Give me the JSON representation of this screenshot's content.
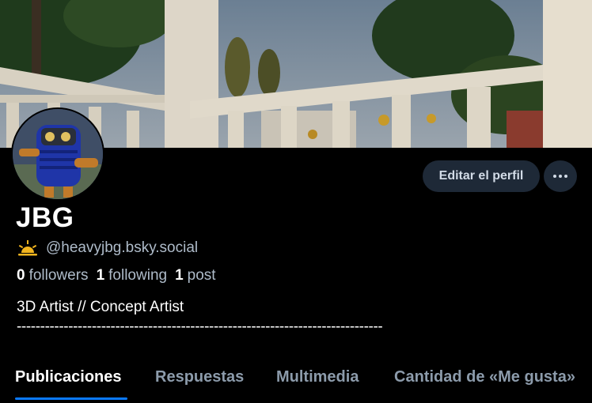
{
  "profile": {
    "display_name": "JBG",
    "handle": "@heavyjbg.bsky.social",
    "bio_line1": "3D Artist // Concept Artist",
    "bio_line2": "------------------------------------------------------------------------------"
  },
  "stats": {
    "followers_count": "0",
    "followers_label": "followers",
    "following_count": "1",
    "following_label": "following",
    "posts_count": "1",
    "posts_label": "post"
  },
  "actions": {
    "edit_profile_label": "Editar el perfil",
    "more_icon": "ellipsis-icon"
  },
  "tabs": [
    {
      "label": "Publicaciones",
      "active": true
    },
    {
      "label": "Respuestas",
      "active": false
    },
    {
      "label": "Multimedia",
      "active": false
    },
    {
      "label": "Cantidad de «Me gusta»",
      "active": false
    }
  ],
  "icons": {
    "handle_badge": "sun-icon"
  },
  "colors": {
    "background": "#000000",
    "accent": "#0a7aff",
    "button_bg": "#1e2937",
    "muted_text": "#aebbc9"
  }
}
